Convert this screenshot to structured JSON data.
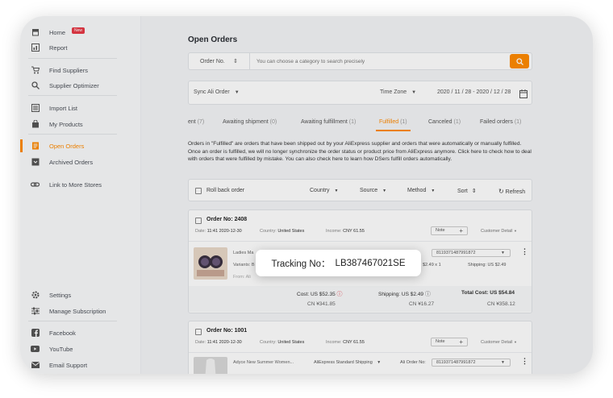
{
  "sidebar": {
    "items": [
      {
        "label": "Home",
        "icon": "store-icon",
        "badge": "New"
      },
      {
        "label": "Report",
        "icon": "chart-icon"
      },
      {
        "label": "Find Suppliers",
        "icon": "cart-icon"
      },
      {
        "label": "Supplier Optimizer",
        "icon": "search-icon"
      },
      {
        "label": "Import List",
        "icon": "list-icon"
      },
      {
        "label": "My Products",
        "icon": "bag-icon"
      },
      {
        "label": "Open Orders",
        "icon": "order-icon",
        "active": true
      },
      {
        "label": "Archived Orders",
        "icon": "archive-icon"
      },
      {
        "label": "Link to More Stores",
        "icon": "link-icon"
      },
      {
        "label": "Settings",
        "icon": "gear-icon"
      },
      {
        "label": "Manage Subscription",
        "icon": "sliders-icon"
      },
      {
        "label": "Facebook",
        "icon": "facebook-icon"
      },
      {
        "label": "YouTube",
        "icon": "youtube-icon"
      },
      {
        "label": "Email Support",
        "icon": "mail-icon"
      }
    ]
  },
  "page": {
    "title": "Open Orders"
  },
  "search": {
    "category": "Order No.",
    "placeholder": "You can choose a category to search precisely"
  },
  "filters": {
    "sync": "Sync Ali Order",
    "timezone": "Time Zone",
    "date_range": "2020 / 11 / 28 - 2020 / 12 / 28"
  },
  "tabs": [
    {
      "label": "ent",
      "count": "(7)"
    },
    {
      "label": "Awaiting shipment",
      "count": "(0)"
    },
    {
      "label": "Awaiting fulfillment",
      "count": "(1)"
    },
    {
      "label": "Fulfilled",
      "count": "(1)",
      "active": true
    },
    {
      "label": "Canceled",
      "count": "(1)"
    },
    {
      "label": "Failed orders",
      "count": "(1)"
    }
  ],
  "notice": "Orders in \"Fulfilled\" are orders that have been shipped out by your AliExpress supplier and orders that were automatically or manually fulfilled. Once an order is fulfilled, we will no longer synchronize the order status or product price from AliExpress anymore. Click here to check how to deal with orders that were fulfilled by mistake. You can also check here to learn how DSers fulfill orders automatically.",
  "toolbar": {
    "rollback": "Roll back order",
    "country": "Country",
    "source": "Source",
    "method": "Method",
    "sort": "Sort",
    "refresh": "Refresh"
  },
  "orders": [
    {
      "number": "Order No: 2408",
      "date_label": "Date:",
      "date": "11:41 2020-12-30",
      "country_label": "Country:",
      "country": "United States",
      "income_label": "Income:",
      "income": "CNY 61.55",
      "note": "Note",
      "customer_detail": "Customer Detail",
      "product": "Ladies Ma",
      "variants": "Variants: B",
      "from": "From: Ali",
      "ali_order_id": "8119371487991872",
      "price": "$2.49 x 1",
      "shipping_small": "Shipping: US $2.49",
      "cost": "Cost: US $52.35",
      "cost_cny": "CN ¥341.85",
      "shipping": "Shipping: US $2.49",
      "shipping_cny": "CN ¥16.27",
      "total": "Total Cost: US $54.84",
      "total_cny": "CN ¥358.12"
    },
    {
      "number": "Order No: 1001",
      "date_label": "Date:",
      "date": "11:41 2020-12-30",
      "country_label": "Country:",
      "country": "United States",
      "income_label": "Income:",
      "income": "CNY 61.55",
      "note": "Note",
      "customer_detail": "Customer Detail",
      "product": "Adyce New Summer Women...",
      "shipping_method": "AliExpress Standard Shipping",
      "ali_order_label": "Ali Order No:",
      "ali_order_id": "8119371487991872"
    }
  ],
  "tooltip": {
    "label": "Tracking No：",
    "value": "LB387467021SE"
  },
  "colors": {
    "accent": "#ff8a00",
    "badge": "#e63946"
  }
}
